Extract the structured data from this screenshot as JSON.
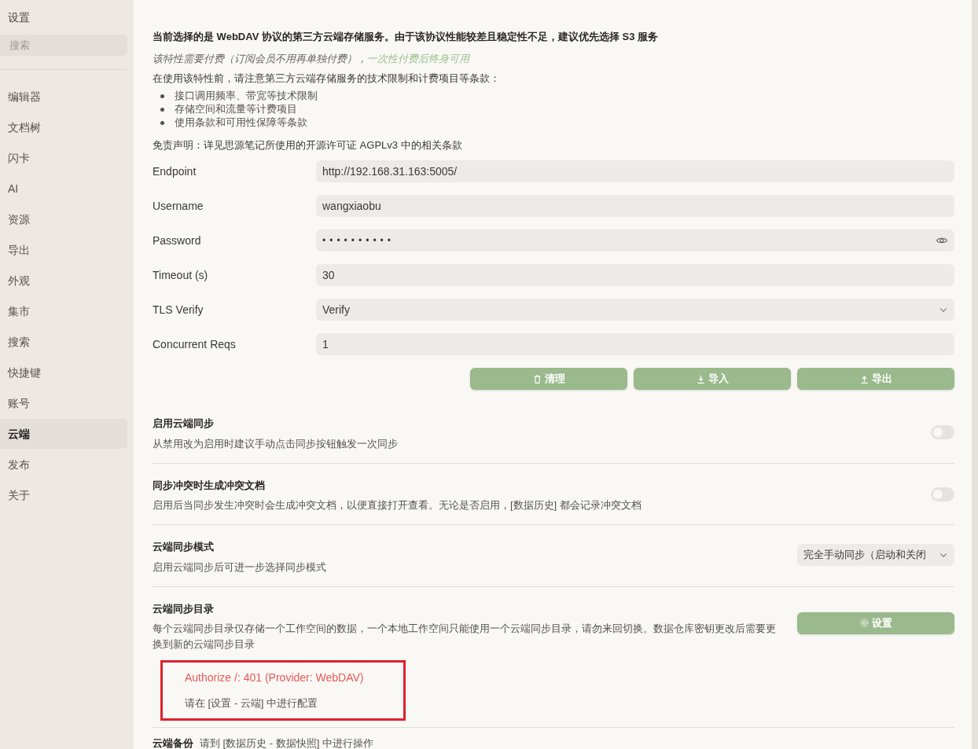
{
  "sidebar": {
    "title": "设置",
    "search": {
      "placeholder": "搜索"
    },
    "items": [
      {
        "label": "编辑器",
        "selected": false
      },
      {
        "label": "文档树",
        "selected": false
      },
      {
        "label": "闪卡",
        "selected": false
      },
      {
        "label": "AI",
        "selected": false
      },
      {
        "label": "资源",
        "selected": false
      },
      {
        "label": "导出",
        "selected": false
      },
      {
        "label": "外观",
        "selected": false
      },
      {
        "label": "集市",
        "selected": false
      },
      {
        "label": "搜索",
        "selected": false
      },
      {
        "label": "快捷键",
        "selected": false
      },
      {
        "label": "账号",
        "selected": false
      },
      {
        "label": "云端",
        "selected": true
      },
      {
        "label": "发布",
        "selected": false
      },
      {
        "label": "关于",
        "selected": false
      }
    ]
  },
  "notice": {
    "headline": "当前选择的是 WebDAV 协议的第三方云端存储服务。由于该协议性能较差且稳定性不足，建议优先选择 S3 服务",
    "paid_note": "该特性需要付费（订阅会员不用再单独付费），",
    "paid_link": "一次性付费后终身可用",
    "intro": "在使用该特性前，请注意第三方云端存储服务的技术限制和计费项目等条款：",
    "bullets": [
      "接口调用频率、带宽等技术限制",
      "存储空间和流量等计费项目",
      "使用条款和可用性保障等条款"
    ],
    "disclaimer": "免责声明：详见思源笔记所使用的开源许可证 AGPLv3 中的相关条款"
  },
  "form": [
    {
      "kind": "text",
      "label": "Endpoint",
      "value": "http://192.168.31.163:5005/"
    },
    {
      "kind": "text",
      "label": "Username",
      "value": "wangxiaobu"
    },
    {
      "kind": "password",
      "label": "Password",
      "value": "••••••••••"
    },
    {
      "kind": "text",
      "label": "Timeout (s)",
      "value": "30"
    },
    {
      "kind": "select",
      "label": "TLS Verify",
      "value": "Verify"
    },
    {
      "kind": "text",
      "label": "Concurrent Reqs",
      "value": "1"
    }
  ],
  "actions": [
    {
      "kind": "trash",
      "label": "清理"
    },
    {
      "kind": "download",
      "label": "导入"
    },
    {
      "kind": "upload",
      "label": "导出"
    }
  ],
  "settings": [
    {
      "kind": "switch",
      "title": "启用云端同步",
      "description": "从禁用改为启用时建议手动点击同步按钮触发一次同步",
      "on": false
    },
    {
      "kind": "switch",
      "title": "同步冲突时生成冲突文档",
      "description": "启用后当同步发生冲突时会生成冲突文档，以便直接打开查看。无论是否启用，[数据历史] 都会记录冲突文档",
      "on": false
    },
    {
      "kind": "select",
      "title": "云端同步模式",
      "description": "启用云端同步后可进一步选择同步模式",
      "value": "完全手动同步（启动和关闭"
    },
    {
      "kind": "button",
      "title": "云端同步目录",
      "description": "每个云端同步目录仅存储一个工作空间的数据，一个本地工作空间只能使用一个云端同步目录，请勿来回切换。数据仓库密钥更改后需要更换到新的云端同步目录",
      "button": "设置",
      "error": "Authorize /: 401 (Provider: WebDAV)",
      "hint": "请在 [设置 - 云端] 中进行配置"
    }
  ],
  "backup": {
    "title": "云端备份",
    "description": "请到 [数据历史 - 数据快照] 中进行操作"
  }
}
